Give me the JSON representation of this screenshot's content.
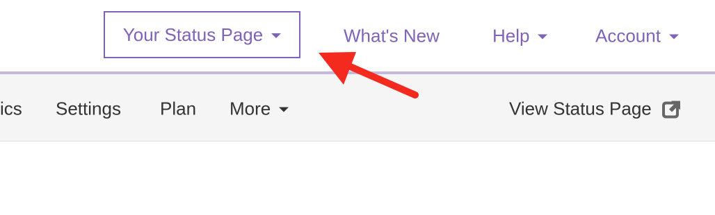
{
  "topnav": {
    "status_page_label": "Your Status Page",
    "whats_new_label": "What's New",
    "help_label": "Help",
    "account_label": "Account"
  },
  "subnav": {
    "partial_label": "ics",
    "settings_label": "Settings",
    "plan_label": "Plan",
    "more_label": "More",
    "view_status_label": "View Status Page"
  },
  "colors": {
    "brand_purple": "#7f63b8",
    "divider_purple": "#c3b6df",
    "annotation_red": "#f52a1e",
    "subbar_bg": "#f5f5f5",
    "subnav_text": "#333333"
  },
  "icons": {
    "dropdown": "caret-down-icon",
    "external": "external-link-icon",
    "annotation": "red-arrow-icon"
  }
}
